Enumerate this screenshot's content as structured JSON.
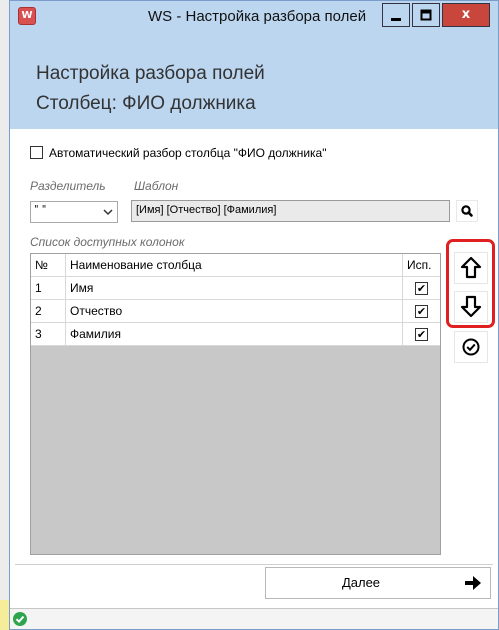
{
  "window": {
    "title": "WS - Настройка разбора полей",
    "app_icon_glyph": "W",
    "close_glyph": "x"
  },
  "header": {
    "line1": "Настройка разбора полей",
    "line2": "Столбец: ФИО должника"
  },
  "auto_parse": {
    "label": "Автоматический разбор столбца \"ФИО должника\"",
    "checked": false
  },
  "separator": {
    "label": "Разделитель",
    "value": "\" \""
  },
  "template": {
    "label": "Шаблон",
    "value": "[Имя] [Отчество] [Фамилия]"
  },
  "columns_list": {
    "label": "Список доступных колонок",
    "headers": {
      "num": "№",
      "name": "Наименование столбца",
      "use": "Исп."
    },
    "rows": [
      {
        "num": "1",
        "name": "Имя",
        "checked": true
      },
      {
        "num": "2",
        "name": "Отчество",
        "checked": true
      },
      {
        "num": "3",
        "name": "Фамилия",
        "checked": true
      }
    ]
  },
  "footer": {
    "next_label": "Далее"
  },
  "icons": {
    "search": "search-icon",
    "move_up": "arrow-up-icon",
    "move_down": "arrow-down-icon",
    "apply": "check-circle-icon",
    "next": "arrow-right-icon",
    "status": "ok-status-icon"
  },
  "colors": {
    "title_bg": "#bcd6f0",
    "close_bg": "#c9463d",
    "highlight": "#e02020",
    "status_ok": "#2ea44f"
  }
}
